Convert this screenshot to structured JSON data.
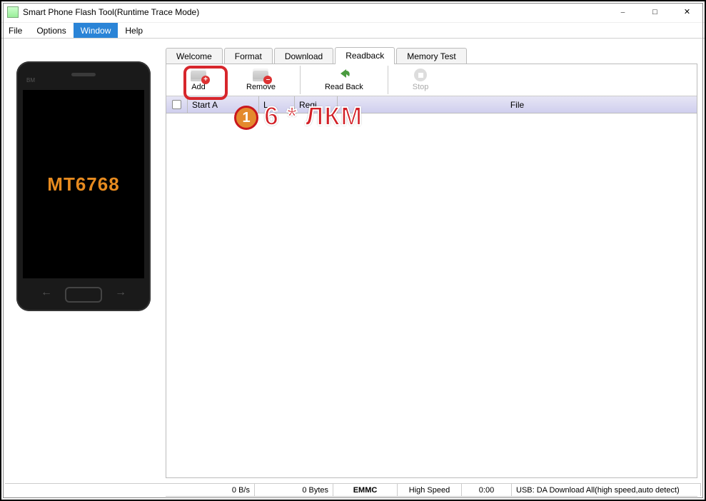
{
  "title": "Smart Phone Flash Tool(Runtime Trace Mode)",
  "menu": {
    "file": "File",
    "options": "Options",
    "window": "Window",
    "help": "Help"
  },
  "tabs": {
    "welcome": "Welcome",
    "format": "Format",
    "download": "Download",
    "readback": "Readback",
    "memory": "Memory Test"
  },
  "toolbar": {
    "add": "Add",
    "remove": "Remove",
    "readback": "Read Back",
    "stop": "Stop"
  },
  "table": {
    "start": "Start A",
    "l": "L",
    "regi": "Regi",
    "file": "File"
  },
  "phone": {
    "chip": "MT6768",
    "bm": "BM"
  },
  "status": {
    "speed": "0 B/s",
    "bytes": "0 Bytes",
    "storage": "EMMC",
    "mode": "High Speed",
    "time": "0:00",
    "usb": "USB: DA Download All(high speed,auto detect)"
  },
  "annotation": {
    "badge": "1",
    "text": "6 * ЛКМ"
  }
}
